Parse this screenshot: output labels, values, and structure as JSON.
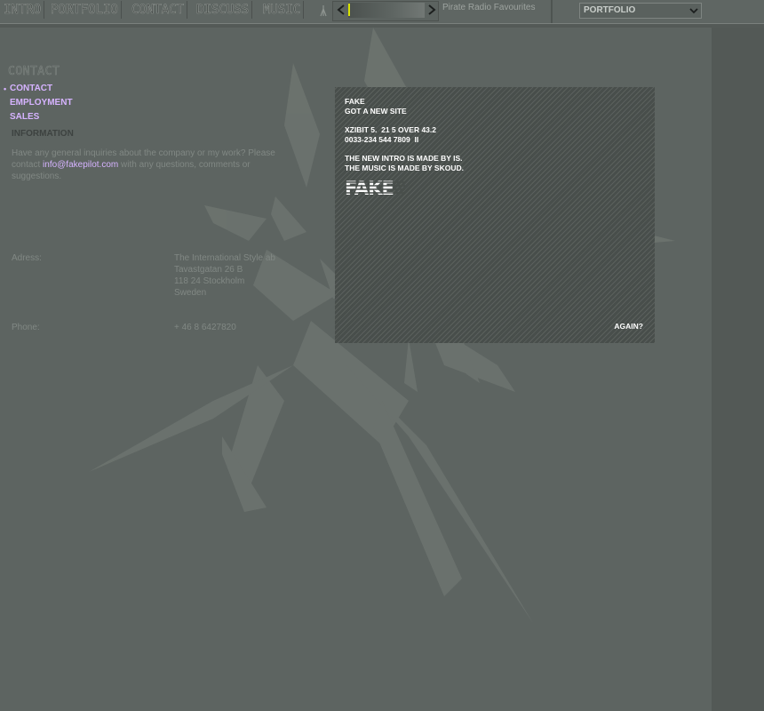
{
  "nav": {
    "items": [
      "INTRO",
      "PORTFOLIO",
      "CONTACT",
      "DISCUSS",
      "MUSIC"
    ]
  },
  "radio": {
    "label": "Pirate Radio Favourites"
  },
  "section_select": {
    "value": "PORTFOLIO"
  },
  "contact": {
    "heading": "CONTACT",
    "menu": [
      "CONTACT",
      "EMPLOYMENT",
      "SALES"
    ],
    "menu_bullet": "•",
    "info_title": "INFORMATION",
    "info_before": "Have any general inquiries about the company or my work? Please contact ",
    "email": "info@fakepilot.com",
    "info_after": " with any questions, comments or suggestions.",
    "address_label": "Adress:",
    "address_lines": [
      "The International Style ab",
      "Tavastgatan 26 B",
      "118 24 Stockholm",
      "Sweden"
    ],
    "phone_label": "Phone:",
    "phone": "+ 46 8 6427820"
  },
  "popup": {
    "line1": "FAKE",
    "line2": "GOT A NEW SITE",
    "line3": "XZIBIT 5.  21 5 OVER 43.2",
    "line4": "0033-234 544 7809  II",
    "line5": "THE NEW INTRO IS MADE BY IS.",
    "line6": "THE MUSIC IS MADE BY SKOUD.",
    "logo_text": "FAKE",
    "again": "AGAIN?"
  },
  "colors": {
    "link": "#d6b3ff",
    "background": "#5d6461",
    "accent_caret": "#d8e300"
  }
}
